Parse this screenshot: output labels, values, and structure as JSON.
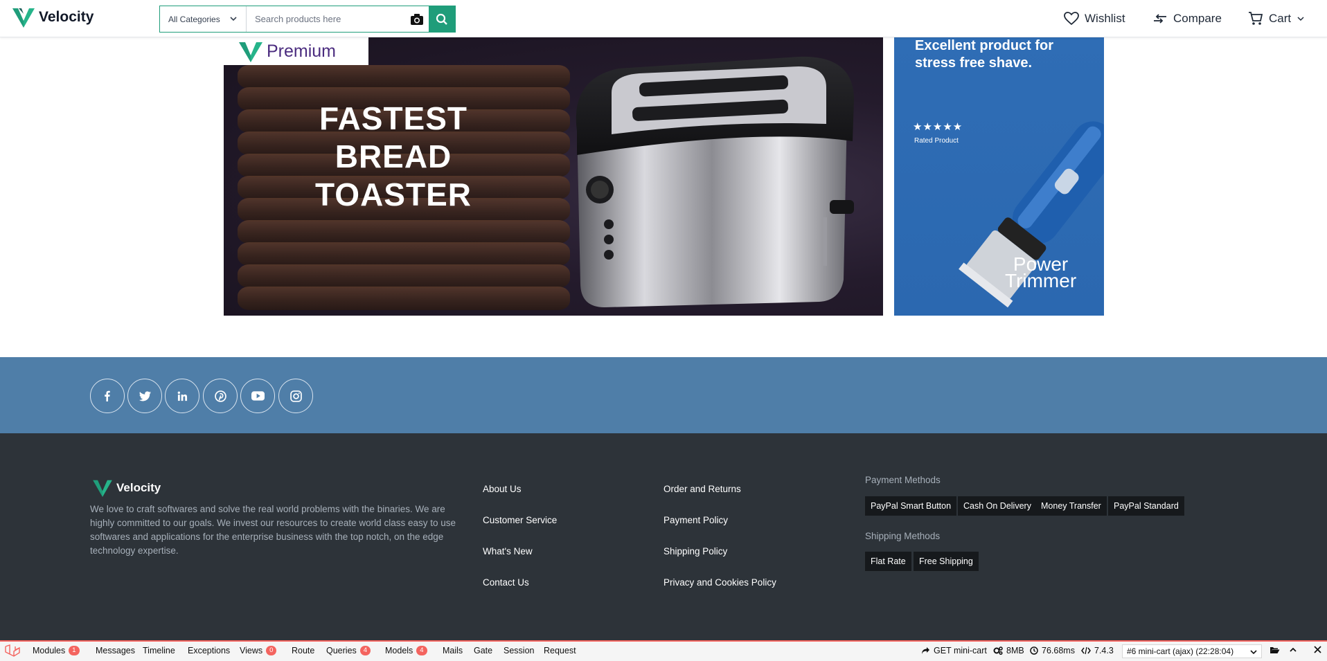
{
  "header": {
    "brand": "Velocity",
    "category_select": "All Categories",
    "search_placeholder": "Search products here",
    "wishlist_label": "Wishlist",
    "compare_label": "Compare",
    "cart_label": "Cart"
  },
  "banner_main": {
    "badge": "Premium",
    "headline": [
      "FASTEST",
      "BREAD",
      "TOASTER"
    ]
  },
  "banner_side": {
    "headline": "Excellent product for stress free shave.",
    "rating": "★★★★★",
    "rated_label": "Rated Product",
    "product_title": [
      "Power",
      "Trimmer"
    ]
  },
  "social": {
    "icons": [
      "facebook-icon",
      "twitter-icon",
      "linkedin-icon",
      "pinterest-icon",
      "youtube-icon",
      "instagram-icon"
    ]
  },
  "footer": {
    "brand": "Velocity",
    "about": "We love to craft softwares and solve the real world problems with the binaries. We are highly committed to our goals. We invest our resources to create world class easy to use softwares and applications for the enterprise business with the top notch, on the edge technology expertise.",
    "links_col1": [
      "About Us",
      "Customer Service",
      "What's New",
      "Contact Us"
    ],
    "links_col2": [
      "Order and Returns",
      "Payment Policy",
      "Shipping Policy",
      "Privacy and Cookies Policy"
    ],
    "payment_heading": "Payment Methods",
    "payment_methods": [
      "PayPal Smart Button",
      "Cash On Delivery",
      "Money Transfer",
      "PayPal Standard"
    ],
    "shipping_heading": "Shipping Methods",
    "shipping_methods": [
      "Flat Rate",
      "Free Shipping"
    ]
  },
  "debugbar": {
    "tabs": [
      {
        "label": "Modules",
        "badge": "1"
      },
      {
        "label": "Messages",
        "badge": ""
      },
      {
        "label": "Timeline",
        "badge": ""
      },
      {
        "label": "Exceptions",
        "badge": ""
      },
      {
        "label": "Views",
        "badge": "0"
      },
      {
        "label": "Route",
        "badge": ""
      },
      {
        "label": "Queries",
        "badge": "4"
      },
      {
        "label": "Models",
        "badge": "4"
      },
      {
        "label": "Mails",
        "badge": ""
      },
      {
        "label": "Gate",
        "badge": ""
      },
      {
        "label": "Session",
        "badge": ""
      },
      {
        "label": "Request",
        "badge": ""
      }
    ],
    "request": "GET mini-cart",
    "memory": "8MB",
    "duration": "76.68ms",
    "php_version": "7.4.3",
    "selected_request": "#6 mini-cart (ajax) (22:28:04)"
  },
  "colors": {
    "accent": "#1f9d7a",
    "social_band": "#4f7ea8",
    "footer_bg": "#2d3339",
    "debug_accent": "#f4645f",
    "side_banner": "#2f6db5"
  }
}
